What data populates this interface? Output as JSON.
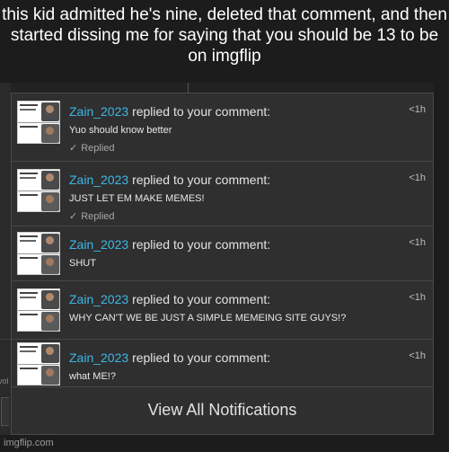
{
  "caption": "this kid admitted he's nine, deleted that comment, and then started dissing me for saying that you should be 13 to be on imgflip",
  "background": {
    "left_fragment": "vol"
  },
  "notifications": [
    {
      "username": "Zain_2023",
      "action": "replied to your comment:",
      "time": "<1h",
      "message": "Yuo should know better",
      "status": "Replied",
      "status_icon": "check-icon"
    },
    {
      "username": "Zain_2023",
      "action": "replied to your comment:",
      "time": "<1h",
      "message": "JUST LET EM MAKE MEMES!",
      "status": "Replied",
      "status_icon": "check-icon"
    },
    {
      "username": "Zain_2023",
      "action": "replied to your comment:",
      "time": "<1h",
      "message": "SHUT",
      "status": ""
    },
    {
      "username": "Zain_2023",
      "action": "replied to your comment:",
      "time": "<1h",
      "message": "WHY CAN'T WE BE JUST A SIMPLE MEMEING SITE GUYS!?",
      "status": ""
    },
    {
      "username": "Zain_2023",
      "action": "replied to your comment:",
      "time": "<1h",
      "message": "what ME!?",
      "status": ""
    }
  ],
  "view_all_label": "View All Notifications",
  "watermark": "imgflip.com",
  "colors": {
    "username": "#3fb6e6",
    "panel_bg": "#2f2f2f",
    "page_bg": "#1c1c1c"
  }
}
